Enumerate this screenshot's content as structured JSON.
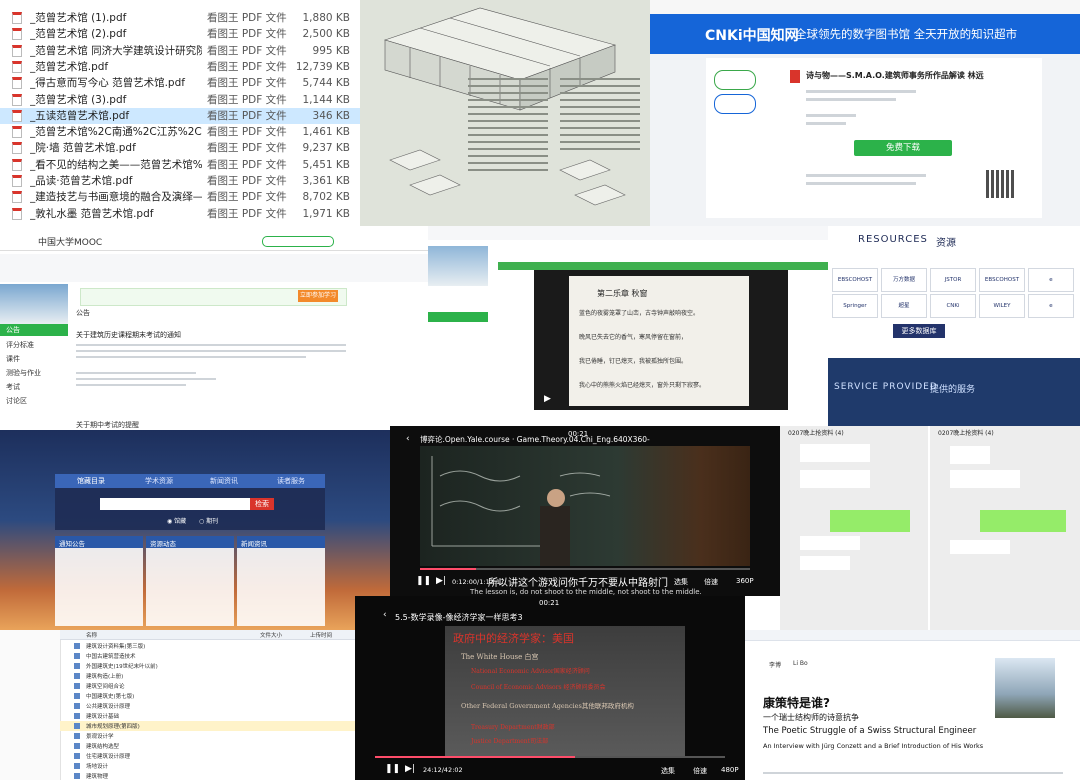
{
  "files": [
    {
      "name": "_范曾艺术馆 (1).pdf",
      "app": "看图王 PDF 文件",
      "size": "1,880 KB"
    },
    {
      "name": "_范曾艺术馆 (2).pdf",
      "app": "看图王 PDF 文件",
      "size": "2,500 KB"
    },
    {
      "name": "_范曾艺术馆 同济大学建筑设计研究院...",
      "app": "看图王 PDF 文件",
      "size": "995 KB"
    },
    {
      "name": "_范曾艺术馆.pdf",
      "app": "看图王 PDF 文件",
      "size": "12,739 KB"
    },
    {
      "name": "_得古意而写今心 范曾艺术馆.pdf",
      "app": "看图王 PDF 文件",
      "size": "5,744 KB"
    },
    {
      "name": "_范曾艺术馆 (3).pdf",
      "app": "看图王 PDF 文件",
      "size": "1,144 KB"
    },
    {
      "name": "_五读范曾艺术馆.pdf",
      "app": "看图王 PDF 文件",
      "size": "346 KB"
    },
    {
      "name": "_范曾艺术馆%2C南通%2C江苏%2C中...",
      "app": "看图王 PDF 文件",
      "size": "1,461 KB"
    },
    {
      "name": "_院·墙 范曾艺术馆.pdf",
      "app": "看图王 PDF 文件",
      "size": "9,237 KB"
    },
    {
      "name": "_看不见的结构之美——范曾艺术馆%26...",
      "app": "看图王 PDF 文件",
      "size": "5,451 KB"
    },
    {
      "name": "_品读·范曾艺术馆.pdf",
      "app": "看图王 PDF 文件",
      "size": "3,361 KB"
    },
    {
      "name": "_建造技艺与书画意境的融合及演绎——...",
      "app": "看图王 PDF 文件",
      "size": "8,702 KB"
    },
    {
      "name": "_敦礼水墨 范曾艺术馆.pdf",
      "app": "看图王 PDF 文件",
      "size": "1,971 KB"
    }
  ],
  "cnki": {
    "logo": "CNKi中国知网",
    "slogan": "全球领先的数字图书馆  全天开放的知识超市",
    "doc_title": "诗与物——S.M.A.O.建筑师事务所作品解读 林远",
    "download": "免费下载"
  },
  "mooc": {
    "brand": "中国大学MOOC",
    "announce": "公告",
    "notice_title": "关于建筑历史课程期末考试的通知",
    "join": "立即参加学习",
    "side": [
      "公告",
      "评分标准",
      "课件",
      "测验与作业",
      "考试",
      "讨论区"
    ],
    "bottom": "关于期中考试的提醒"
  },
  "lesson": {
    "chapter": "第二乐章    秋窗",
    "lines": [
      "蓝色的夜雾笼罩了山峦，古寺钟声敲响夜空。",
      "晚风已失去它的香气，寒风停留在窗前，",
      "我已倦睡，钉已熄灭，我被孤独所包围。",
      "我心中的熊熊火焰已经熄灭，窗外只剩下寂寥。"
    ]
  },
  "resources": {
    "title": "RESOURCES",
    "title_cn": "资源",
    "logos": [
      "EBSCOHOST",
      "万方数据",
      "JSTOR",
      "EBSCOHOST",
      "e",
      "Springer",
      "超星",
      "CNKi",
      "WILEY",
      "e"
    ],
    "more": "更多数据库",
    "service": "SERVICE PROVIDED",
    "service_cn": "提供的服务"
  },
  "library": {
    "tabs": [
      "馆藏目录",
      "学术资源",
      "新闻资讯",
      "读者服务"
    ],
    "search_btn": "检索",
    "radios": [
      "馆藏",
      "期刊"
    ],
    "boxes": [
      "通知公告",
      "资源动态",
      "新闻资讯"
    ]
  },
  "yale": {
    "title": "博弈论.Open.Yale.course · Game.Theory.04.Chi_Eng.640X360-1",
    "subtitle_cn": "所以讲这个游戏问你千万不要从中路射门",
    "subtitle_en": "The lesson is, do not shoot to the middle, not shoot to the middle.",
    "time": "0:12:00/1:12:17",
    "quality": "360P",
    "speed": "倍速",
    "episode": "选集",
    "clock": "00:21"
  },
  "chat": {
    "title1": "0207晚上抢资料 (4)",
    "title2": "0207晚上抢资料 (4)"
  },
  "table": {
    "headers": [
      "名称",
      "文件大小",
      "上传时间"
    ],
    "rows": [
      "建筑设计资料集(第三版)",
      "中国古建筑营造技术",
      "外国建筑史(19世纪末叶以前)",
      "建筑构造(上册)",
      "建筑空间组合论",
      "中国建筑史(第七版)",
      "公共建筑设计原理",
      "建筑设计基础",
      "城市规划原理(第四版)",
      "景观设计学",
      "建筑结构选型",
      "住宅建筑设计原理",
      "场地设计",
      "建筑物理"
    ]
  },
  "econ": {
    "title": "5.5-数学录像-像经济学家一样思考3",
    "clock": "00:21",
    "slide_title": "政府中的经济学家：美国",
    "bullets": [
      "The White House 白宫",
      "National Economic Advisor国家经济顾问",
      "Council of Economic Advisors 经济顾问委员会",
      "Other Federal Government Agencies其他联邦政府机构",
      "Treasury Department财政部",
      "Justice Department司法部"
    ],
    "time": "24:12/42:02",
    "episode": "选集",
    "speed": "倍速",
    "quality": "480P"
  },
  "article": {
    "author": "李博",
    "author_en": "Li Bo",
    "title_cn": "康策特是谁?",
    "subtitle_cn": "一个瑞士结构师的诗意抗争",
    "title_en": "The Poetic Struggle of a Swiss Structural Engineer",
    "sub_en": "An Interview with Jürg Conzett and a Brief Introduction of His Works"
  }
}
